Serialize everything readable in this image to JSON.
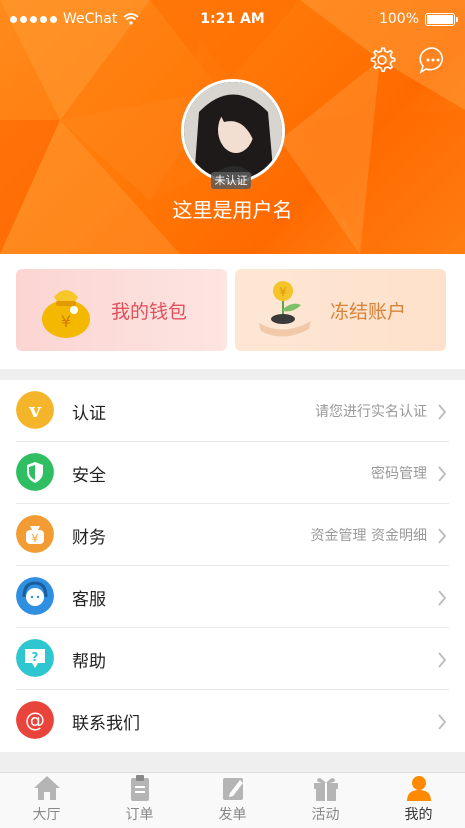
{
  "status_bar": {
    "carrier": "WeChat",
    "time": "1:21 AM",
    "battery": "100%"
  },
  "header": {
    "badge": "未认证",
    "username": "这里是用户名",
    "settings_icon": "gear-icon",
    "message_icon": "chat-bubble-icon"
  },
  "cards": {
    "wallet": {
      "label": "我的钱包",
      "icon": "money-bag-icon"
    },
    "frozen": {
      "label": "冻结账户",
      "icon": "coin-plant-hand-icon"
    }
  },
  "menu": [
    {
      "label": "认证",
      "hint": "请您进行实名认证",
      "icon": "verify-v-icon",
      "color": "#f5b52a"
    },
    {
      "label": "安全",
      "hint": "密码管理",
      "icon": "shield-icon",
      "color": "#2fbf62"
    },
    {
      "label": "财务",
      "hint": "资金管理 资金明细",
      "icon": "money-bag-icon",
      "color": "#f39c33"
    },
    {
      "label": "客服",
      "hint": "",
      "icon": "customer-service-icon",
      "color": "#2f8fe0"
    },
    {
      "label": "帮助",
      "hint": "",
      "icon": "help-icon",
      "color": "#2fc7cf"
    },
    {
      "label": "联系我们",
      "hint": "",
      "icon": "at-sign-icon",
      "color": "#e9443c"
    }
  ],
  "tabs": [
    {
      "label": "大厅",
      "icon": "home-icon"
    },
    {
      "label": "订单",
      "icon": "clipboard-icon"
    },
    {
      "label": "发单",
      "icon": "edit-icon"
    },
    {
      "label": "活动",
      "icon": "gift-icon"
    },
    {
      "label": "我的",
      "icon": "person-icon",
      "active": true
    }
  ],
  "colors": {
    "accent": "#ff7a0a",
    "tab_active": "#ff8a00"
  }
}
